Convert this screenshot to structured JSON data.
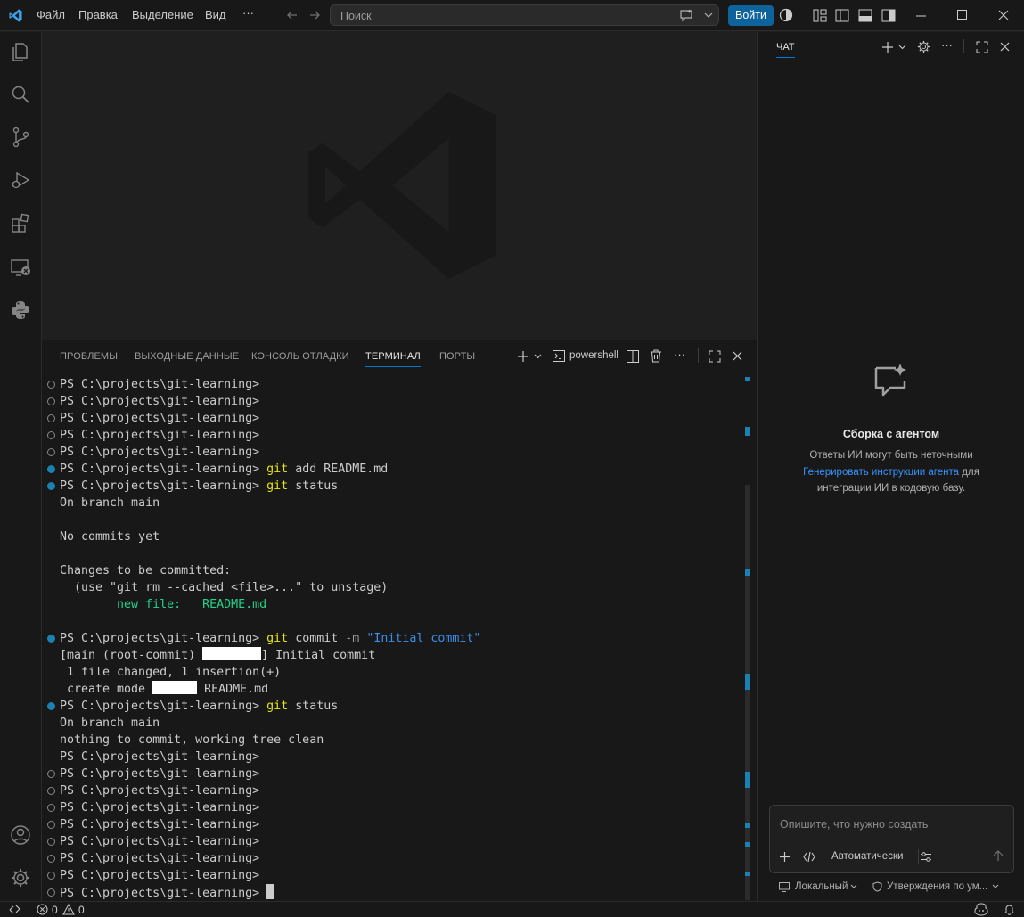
{
  "menu": {
    "file": "Файл",
    "edit": "Правка",
    "selection": "Выделение",
    "view": "Вид",
    "more": "···"
  },
  "search": {
    "placeholder": "Поиск"
  },
  "signin_label": "Войти",
  "panel": {
    "tabs": [
      {
        "label": "ПРОБЛЕМЫ"
      },
      {
        "label": "ВЫХОДНЫЕ ДАННЫЕ"
      },
      {
        "label": "КОНСОЛЬ ОТЛАДКИ"
      },
      {
        "label": "ТЕРМИНАЛ"
      },
      {
        "label": "ПОРТЫ"
      }
    ],
    "active_tab": "ТЕРМИНАЛ",
    "shell_label": "powershell"
  },
  "terminal": {
    "prompt": "PS C:\\projects\\git-learning>",
    "cmd_git": "git",
    "cmd_add": "add README.md",
    "cmd_status": "status",
    "cmd_commit": "commit",
    "cmd_commit_flag": "-m",
    "cmd_commit_msg": "\"Initial commit\"",
    "on_branch": "On branch main",
    "no_commits": "No commits yet",
    "changes_header": "Changes to be committed:",
    "unstage_hint": "  (use \"git rm --cached <file>...\" to unstage)",
    "new_file": "        new file:   README.md",
    "commit_prefix": "[main (root-commit) ",
    "commit_suffix": "] Initial commit",
    "changed_stats": " 1 file changed, 1 insertion(+)",
    "create_prefix": " create mode ",
    "create_suffix": " README.md",
    "clean": "nothing to commit, working tree clean"
  },
  "chat": {
    "tab_label": "ЧАТ",
    "title": "Сборка с агентом",
    "desc_line1": "Ответы ИИ могут быть неточными",
    "desc_link": "Генерировать инструкции агента",
    "desc_after_link": " для",
    "desc_line3": "интеграции ИИ в кодовую базу.",
    "input_placeholder": "Опишите, что нужно создать",
    "mode_label": "Автоматически",
    "footer_local": "Локальный",
    "footer_approvals": "Утверждения по ум..."
  },
  "status": {
    "errors": "0",
    "warnings": "0"
  },
  "colors": {
    "accent": "#0078d4",
    "signin_bg": "#0e639c",
    "git_keyword": "#e5e510",
    "string": "#3b8eea",
    "added": "#23d18b",
    "link": "#3794ff"
  }
}
